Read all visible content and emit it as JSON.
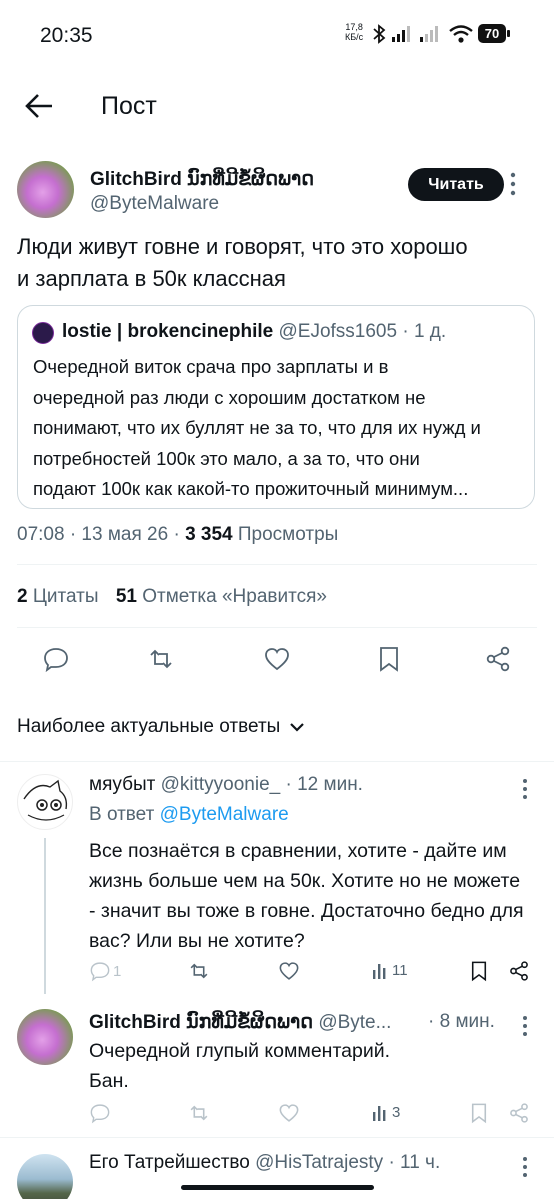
{
  "status_bar": {
    "time": "20:35",
    "net_speed_top": "17,8",
    "net_speed_bottom": "КБ/с",
    "battery": "70"
  },
  "header": {
    "title": "Пост"
  },
  "post": {
    "display_name": "GlitchBird ນົກທີ່ມີຂໍ້ຜິດພາດ",
    "handle": "@ByteMalware",
    "follow_label": "Читать",
    "text_line1": "Люди живут говне и говорят, что это хорошо",
    "text_line2": "и зарплата в 50к классная",
    "quote": {
      "name": "lostie | brokencinephile",
      "handle": "@EJofss1605",
      "time": "· 1 д.",
      "lines": [
        "Очередной виток срача про зарплаты и в",
        "очередной раз люди с хорошим достатком не",
        "понимают, что их буллят не за то, что для их нужд и",
        "потребностей 100к это мало, а за то, что они",
        "подают 100к как какой-то прожиточный минимум..."
      ]
    },
    "meta_time": "07:08 · 13 мая 26 ·",
    "views_count": "3 354",
    "views_label": "Просмотры",
    "quotes_count": "2",
    "quotes_label": "Цитаты",
    "likes_count": "51",
    "likes_label": "Отметка «Нравится»"
  },
  "sort": {
    "label": "Наиболее актуальные ответы"
  },
  "replies": [
    {
      "name": "мяубыт",
      "handle": "@kittyyoonie_",
      "time": "· 12 мин.",
      "reply_to_prefix": "В ответ",
      "reply_to_handle": "@ByteMalware",
      "lines": [
        "Все познаётся в сравнении, хотите - дайте им",
        "жизнь больше чем на 50к. Хотите но не можете",
        "- значит вы тоже в говне. Достаточно бедно для",
        "вас? Или вы не хотите?"
      ],
      "reply_count": "1",
      "views": "11"
    },
    {
      "name": "GlitchBird ນົກທີ່ມີຂໍ້ຜິດພາດ",
      "handle": "@Byte...",
      "time": "· 8 мин.",
      "lines": [
        "Очередной глупый комментарий.",
        "Бан."
      ],
      "views": "3"
    },
    {
      "name": "Его Татрейшество",
      "handle": "@HisTatrajesty",
      "time": "· 11 ч."
    }
  ],
  "colors": {
    "accent": "#1d9bf0",
    "muted": "#536471",
    "text": "#0f1419",
    "border": "#cfd9de"
  }
}
